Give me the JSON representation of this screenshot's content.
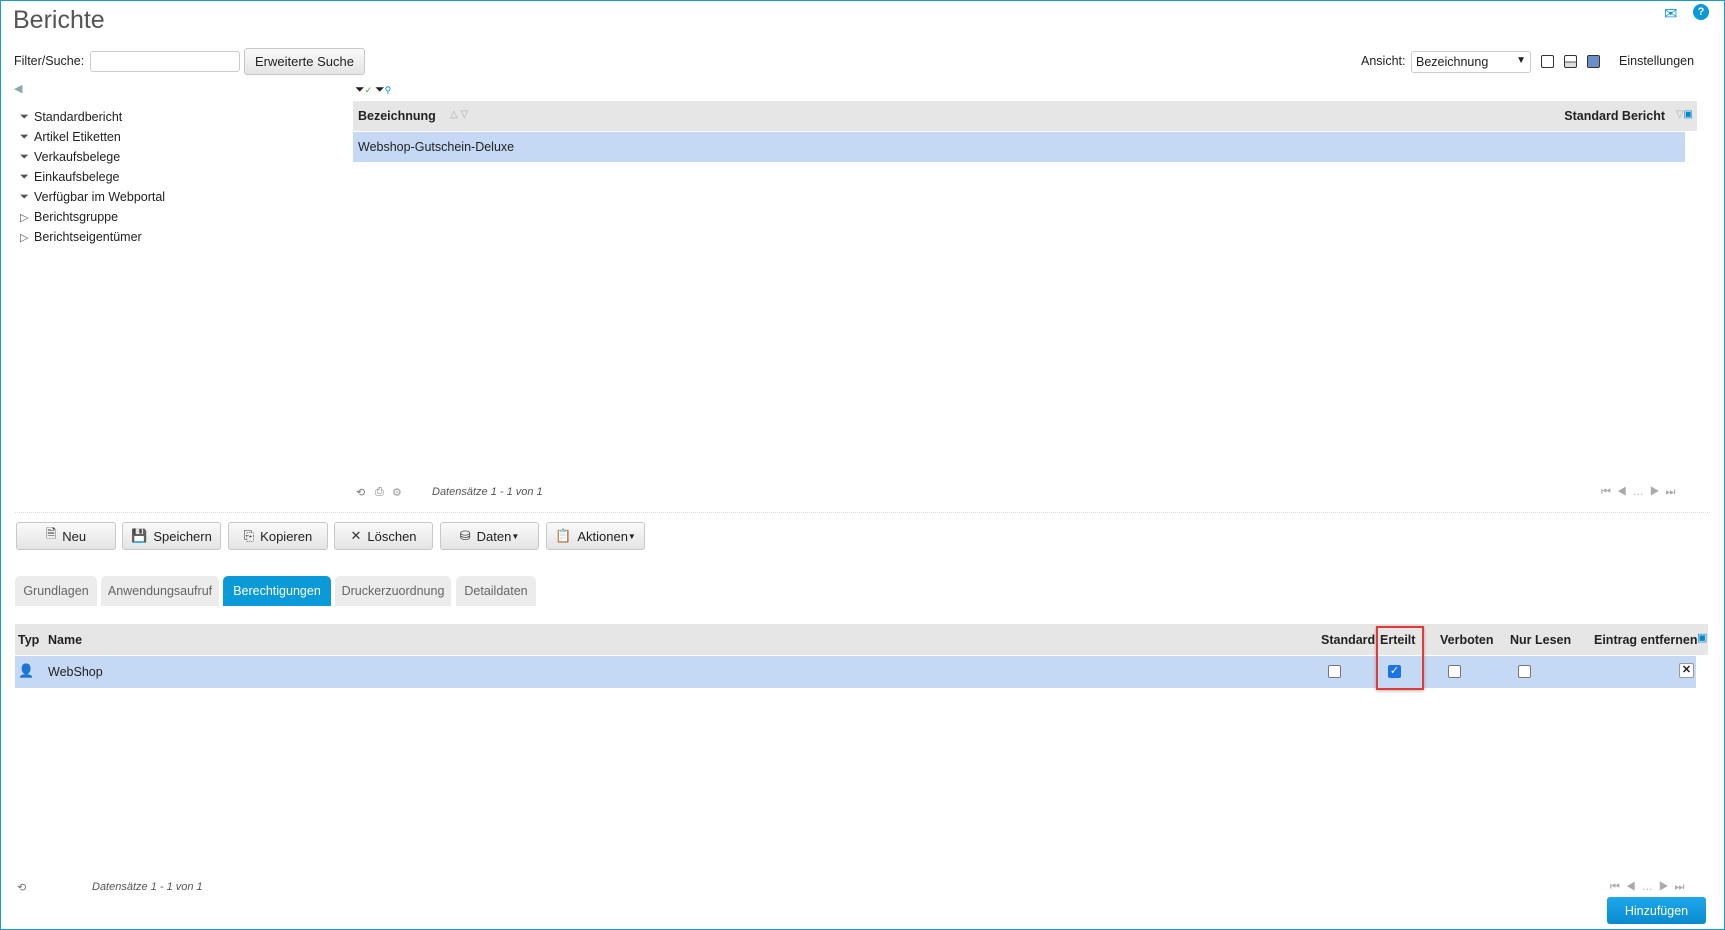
{
  "header": {
    "title": "Berichte",
    "mail_icon": "mail-icon",
    "help_icon": "help-icon"
  },
  "search": {
    "label": "Filter/Suche:",
    "value": "",
    "placeholder": "",
    "advanced_button": "Erweiterte Suche"
  },
  "view": {
    "label": "Ansicht:",
    "selected": "Bezeichnung",
    "settings": "Einstellungen"
  },
  "tree": {
    "items": [
      {
        "label": "Standardbericht",
        "icon": "filter-icon"
      },
      {
        "label": "Artikel Etiketten",
        "icon": "filter-icon"
      },
      {
        "label": "Verkaufsbelege",
        "icon": "filter-icon"
      },
      {
        "label": "Einkaufsbelege",
        "icon": "filter-icon"
      },
      {
        "label": "Verfügbar im Webportal",
        "icon": "filter-icon"
      },
      {
        "label": "Berichtsgruppe",
        "icon": "expand-icon"
      },
      {
        "label": "Berichtseigentümer",
        "icon": "expand-icon"
      }
    ]
  },
  "report_grid": {
    "columns": [
      "Bezeichnung",
      "Standard Bericht"
    ],
    "rows": [
      {
        "name": "Webshop-Gutschein-Deluxe",
        "standard": ""
      }
    ],
    "footer": "Datensätze 1 - 1 von 1",
    "pager": "…"
  },
  "toolbar": {
    "new": "Neu",
    "save": "Speichern",
    "copy": "Kopieren",
    "delete": "Löschen",
    "data": "Daten",
    "actions": "Aktionen"
  },
  "tabs": [
    {
      "label": "Grundlagen"
    },
    {
      "label": "Anwendungsaufruf"
    },
    {
      "label": "Berechtigungen",
      "active": true
    },
    {
      "label": "Druckerzuordnung"
    },
    {
      "label": "Detaildaten"
    }
  ],
  "perm_grid": {
    "columns": {
      "type": "Typ",
      "name": "Name",
      "standard": "Standard",
      "granted": "Erteilt",
      "forbidden": "Verboten",
      "readonly": "Nur Lesen",
      "remove": "Eintrag entfernen"
    },
    "rows": [
      {
        "name": "WebShop",
        "standard": false,
        "granted": true,
        "forbidden": false,
        "readonly": false
      }
    ],
    "footer": "Datensätze 1 - 1 von 1",
    "pager": "…",
    "add_button": "Hinzufügen"
  },
  "colors": {
    "accent": "#0a9ad8",
    "selected_row": "#c5d9f5",
    "highlight": "#e53935"
  }
}
